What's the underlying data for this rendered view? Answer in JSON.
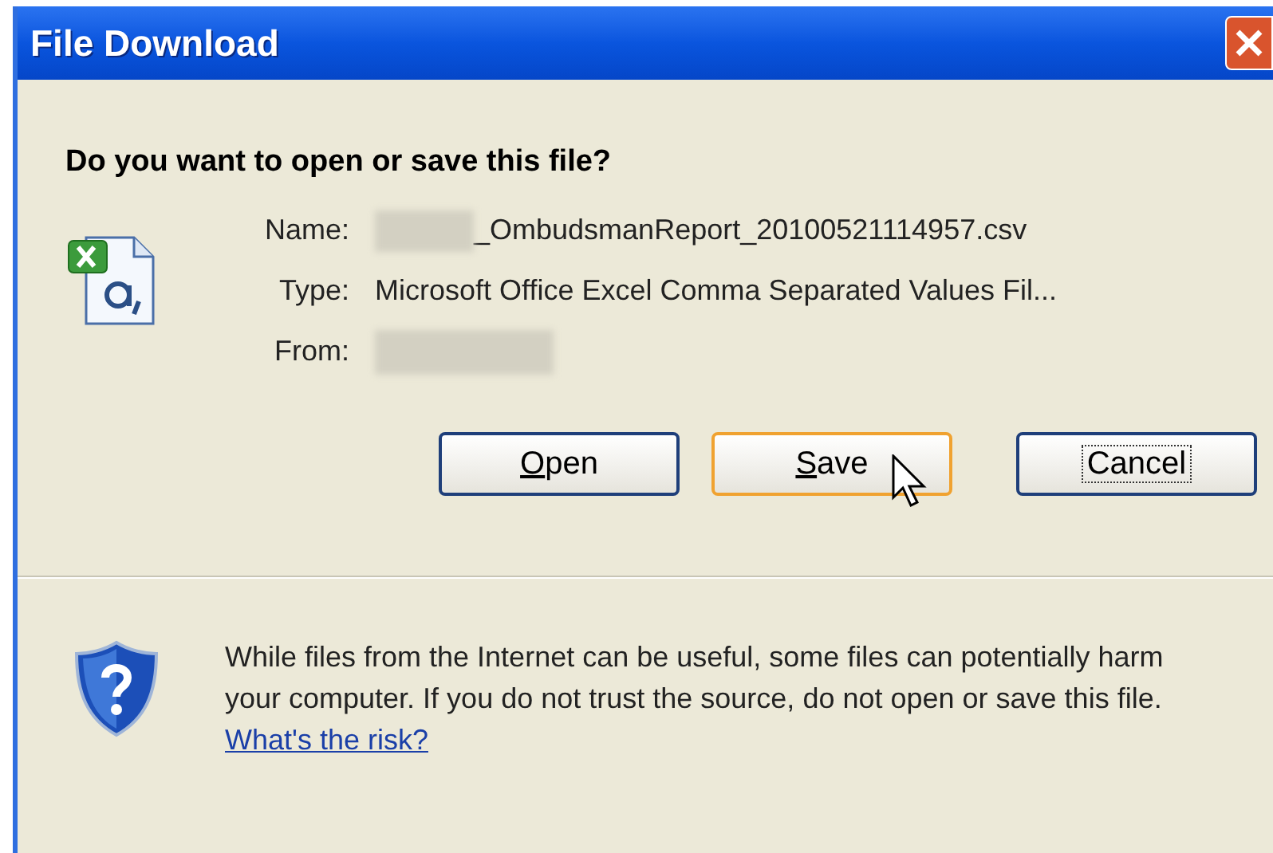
{
  "window": {
    "title": "File Download"
  },
  "heading": "Do you want to open or save this file?",
  "file_info": [
    {
      "label": "Name:",
      "value": "_OmbudsmanReport_20100521114957.csv",
      "redacted_prefix": true
    },
    {
      "label": "Type:",
      "value": "Microsoft Office Excel Comma Separated Values Fil...",
      "redacted_prefix": false
    },
    {
      "label": "From:",
      "redacted_prefix": true
    }
  ],
  "buttons": [
    {
      "label": "Open",
      "mnemonic": true,
      "hover": false,
      "focused": false
    },
    {
      "label": "Save",
      "mnemonic": true,
      "hover": true,
      "focused": false
    },
    {
      "label": "Cancel",
      "mnemonic": false,
      "focused": true,
      "hover": false
    }
  ],
  "warning": {
    "text": "While files from the Internet can be useful, some files can potentially harm your computer. If you do not trust the source, do not open or save this file.",
    "link": "What's the risk?"
  }
}
